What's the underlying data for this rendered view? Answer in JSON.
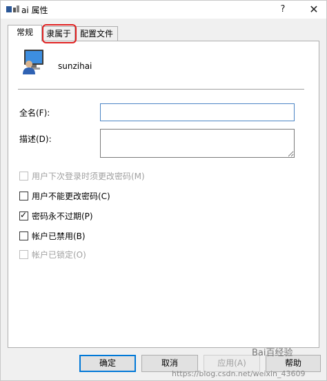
{
  "window": {
    "title": "ai 属性",
    "help_glyph": "?",
    "close_glyph": "✕"
  },
  "tabs": [
    {
      "label": "常规",
      "active": true
    },
    {
      "label": "隶属于",
      "active": false
    },
    {
      "label": "配置文件",
      "active": false
    }
  ],
  "user": {
    "icon": "user-monitor-icon",
    "name": "sunzihai"
  },
  "form": {
    "fullname_label": "全名(F):",
    "fullname_value": "",
    "description_label": "描述(D):",
    "description_value": ""
  },
  "options": [
    {
      "label": "用户下次登录时须更改密码(M)",
      "checked": false,
      "disabled": true
    },
    {
      "label": "用户不能更改密码(C)",
      "checked": false,
      "disabled": false
    },
    {
      "label": "密码永不过期(P)",
      "checked": true,
      "disabled": false
    },
    {
      "label": "帐户已禁用(B)",
      "checked": false,
      "disabled": false
    },
    {
      "label": "帐户已锁定(O)",
      "checked": false,
      "disabled": true
    }
  ],
  "buttons": {
    "ok": "确定",
    "cancel": "取消",
    "apply": "应用(A)",
    "help": "帮助"
  },
  "watermark": {
    "url": "https://blog.csdn.net/weixin_43609",
    "baidu": "Bai百经验"
  },
  "colors": {
    "highlight": "#e02020",
    "focus": "#0078d7"
  }
}
